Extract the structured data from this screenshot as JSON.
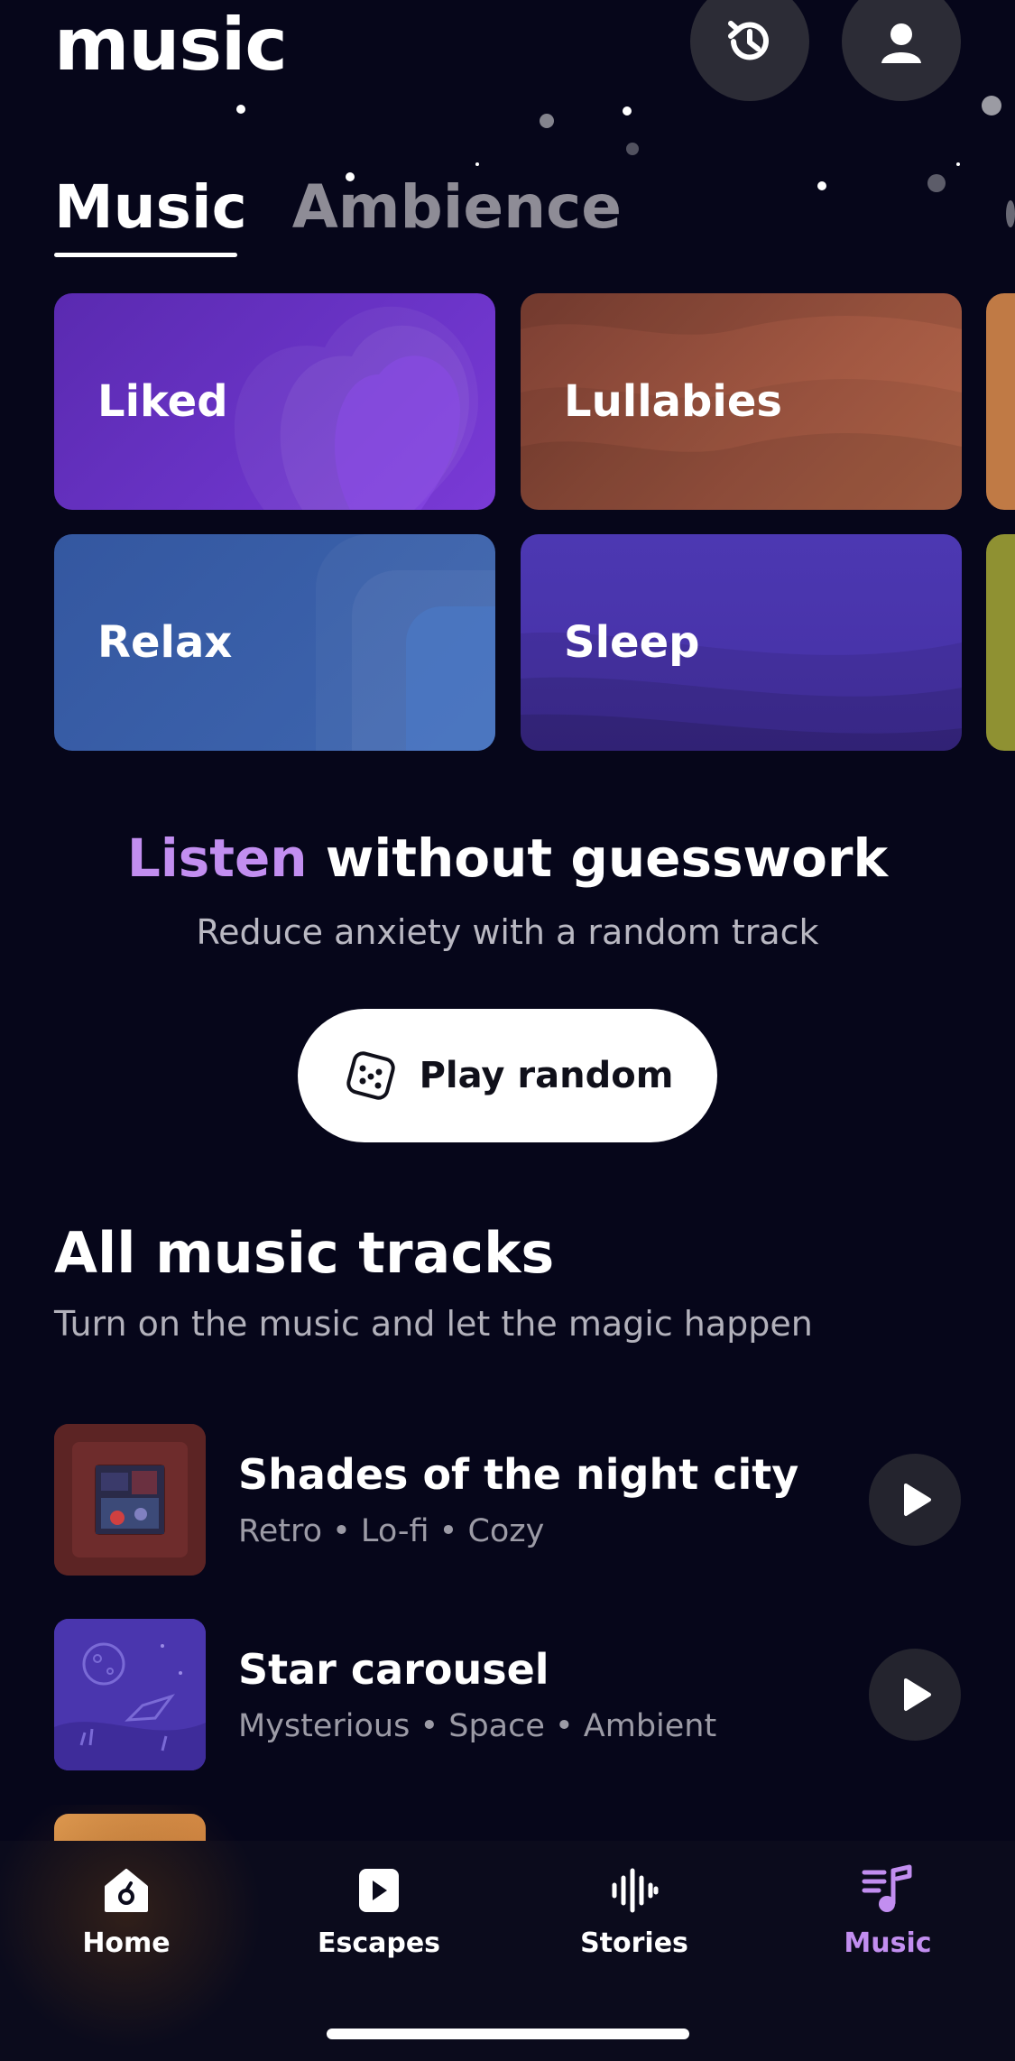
{
  "header": {
    "title": "music",
    "history_icon": "history-icon",
    "profile_icon": "profile-icon"
  },
  "tabs": [
    {
      "label": "Music",
      "active": true
    },
    {
      "label": "Ambience",
      "active": false
    }
  ],
  "categories": [
    {
      "label": "Liked",
      "color": "#6b34c8"
    },
    {
      "label": "Lullabies",
      "color": "#a25842"
    },
    {
      "label": "Relax",
      "color": "#3e66b0"
    },
    {
      "label": "Sleep",
      "color": "#4c38b2"
    }
  ],
  "promo": {
    "title_accent": "Listen",
    "title_rest": "without guesswork",
    "subtitle": "Reduce anxiety with a random track",
    "button_label": "Play random",
    "button_icon": "dice-icon"
  },
  "section": {
    "title": "All music tracks",
    "subtitle": "Turn on the music and let the magic happen"
  },
  "tracks": [
    {
      "title": "Shades of the night city",
      "tags": "Retro • Lo-fi • Cozy"
    },
    {
      "title": "Star carousel",
      "tags": "Mysterious • Space • Ambient"
    }
  ],
  "bottom_nav": [
    {
      "label": "Home",
      "icon": "home-icon",
      "active": false
    },
    {
      "label": "Escapes",
      "icon": "play-square-icon",
      "active": false
    },
    {
      "label": "Stories",
      "icon": "waveform-icon",
      "active": false
    },
    {
      "label": "Music",
      "icon": "music-note-icon",
      "active": true
    }
  ],
  "colors": {
    "background": "#06061a",
    "accent": "#c28ef0",
    "inactive_tab": "#8e8c96"
  }
}
